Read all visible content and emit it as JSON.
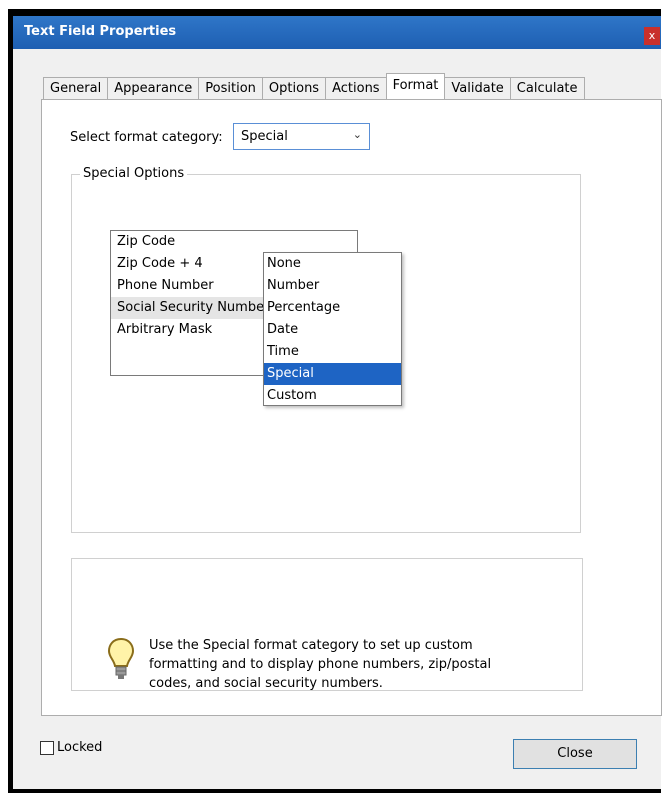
{
  "window": {
    "title": "Text Field Properties",
    "close_glyph": "x"
  },
  "tabs": [
    {
      "label": "General"
    },
    {
      "label": "Appearance"
    },
    {
      "label": "Position"
    },
    {
      "label": "Options"
    },
    {
      "label": "Actions"
    },
    {
      "label": "Format",
      "active": true
    },
    {
      "label": "Validate"
    },
    {
      "label": "Calculate"
    }
  ],
  "format": {
    "category_label": "Select format category:",
    "selected": "Special",
    "options": [
      "None",
      "Number",
      "Percentage",
      "Date",
      "Time",
      "Special",
      "Custom"
    ]
  },
  "special_options": {
    "group_label": "Special Options",
    "items": [
      "Zip Code",
      "Zip Code + 4",
      "Phone Number",
      "Social Security Number",
      "Arbitrary Mask"
    ],
    "selected": "Social Security Number"
  },
  "info": {
    "icon": "lightbulb-icon",
    "text": "Use the Special format category to set up custom formatting and to display phone numbers, zip/postal codes, and social security numbers."
  },
  "footer": {
    "locked_label": "Locked",
    "close_label": "Close"
  },
  "colors": {
    "title_bar": "#2468bd",
    "selection": "#1e64c4",
    "close_x": "#c9302c"
  }
}
